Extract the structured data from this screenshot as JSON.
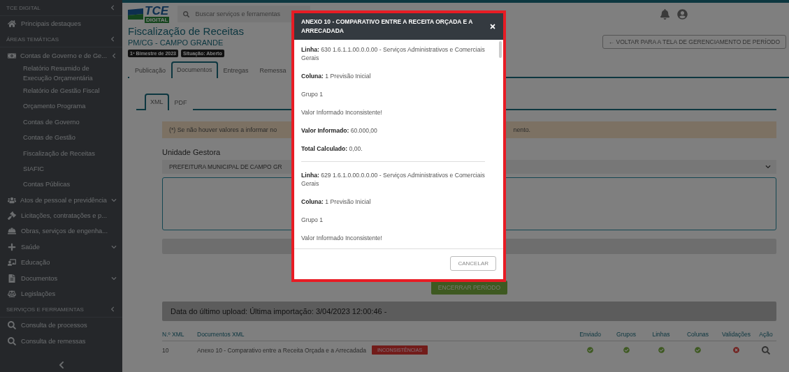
{
  "sidebar": {
    "sections": [
      {
        "title": "TCE DIGITAL",
        "items": [
          {
            "label": "Principais destaques",
            "expandable": false
          }
        ]
      },
      {
        "title": "ÁREAS TEMÁTICAS",
        "items": [
          {
            "label": "Contas de Governo e de Ge...",
            "expandable": true,
            "expanded": true,
            "children": [
              {
                "label": "Relatório Resumido de Execução Orçamentária"
              },
              {
                "label": "Relatório de Gestão Fiscal"
              },
              {
                "label": "Orçamento Programa"
              },
              {
                "label": "Contas de Governo"
              },
              {
                "label": "Contas de Gestão"
              },
              {
                "label": "Fiscalização de Receitas"
              },
              {
                "label": "SIAFIC"
              },
              {
                "label": "Contas Públicas"
              }
            ]
          },
          {
            "label": "Atos de pessoal e previdência",
            "expandable": true,
            "expanded": false
          },
          {
            "label": "Licitações, contratações e p...",
            "expandable": false
          },
          {
            "label": "Obras, serviços de engenha...",
            "expandable": false
          },
          {
            "label": "Saúde",
            "expandable": true,
            "expanded": false
          },
          {
            "label": "Educação",
            "expandable": false
          },
          {
            "label": "Documentos",
            "expandable": true,
            "expanded": false
          },
          {
            "label": "Legislações",
            "expandable": false
          }
        ]
      },
      {
        "title": "SERVIÇOS E FERRAMENTAS",
        "items": [
          {
            "label": "Consulta de processos",
            "expandable": false
          },
          {
            "label": "Consulta de remessas",
            "expandable": false
          }
        ]
      }
    ]
  },
  "header": {
    "logo": {
      "text": "TCE",
      "subtext": "DIGITAL"
    },
    "search": {
      "placeholder": "Buscar serviços e ferramentas"
    }
  },
  "page": {
    "title": "Fiscalização de Receitas",
    "subtitle": "PM/CG - CAMPO GRANDE",
    "badges": [
      "1º Bimestre de 2023",
      "Situação: Aberto"
    ],
    "back_button": "← VOLTAR PARA A TELA DE GERENCIAMENTO DE PERÍODO",
    "tabs": [
      {
        "label": "Publicação",
        "selected": false
      },
      {
        "label": "Documentos",
        "selected": true
      },
      {
        "label": "Entregas",
        "selected": false
      },
      {
        "label": "Remessa",
        "selected": false
      }
    ],
    "subtabs": [
      {
        "label": "XML",
        "selected": true
      },
      {
        "label": "PDF",
        "selected": false
      }
    ],
    "warning": "(*) Se não houver valores a informar no",
    "warning_tail": "nento.",
    "unit_label": "Unidade Gestora",
    "unit_value": "PREFEITURA MUNICIPAL DE CAMPO GR",
    "close_button": "ENCERRAR PERÍODO",
    "upload_info": "Data do último upload: Última importação: 3/04/2023 12:00:46 -",
    "table": {
      "columns": [
        "N.º XML",
        "Documentos XML",
        "Enviado",
        "Grupos",
        "Linhas",
        "Colunas",
        "Validações",
        "Ação"
      ],
      "rows": [
        {
          "number": "10",
          "document": "Anexo 10 - Comparativo entre a Receita Orçada e a Arrecadada",
          "tag": "INCONSISTÊNCIAS",
          "checks": [
            {
              "ok": true
            },
            {
              "ok": true
            },
            {
              "ok": true
            },
            {
              "ok": true
            },
            {
              "ok": false
            }
          ]
        }
      ]
    }
  },
  "modal": {
    "title": "ANEXO 10 - COMPARATIVO ENTRE A RECEITA ORÇADA E A ARRECADADA",
    "blocks": [
      {
        "lines": [
          "**Linha:** 630 1.6.1.1.00.0.0.00 - Serviços Administrativos e Comerciais Gerais",
          "**Coluna:** 1 Previsão Inicial",
          "Grupo 1",
          "Valor Informado Inconsistente!",
          "**Valor Informado:** 60.000,00",
          "**Total Calculado:** 0,00."
        ]
      },
      {
        "lines": [
          "**Linha:** 629 1.6.1.0.00.0.0.00 - Serviços Administrativos e Comerciais Gerais",
          "**Coluna:** 1 Previsão Inicial",
          "Grupo 1",
          "Valor Informado Inconsistente!"
        ]
      }
    ],
    "cancel_button": "CANCELAR"
  }
}
